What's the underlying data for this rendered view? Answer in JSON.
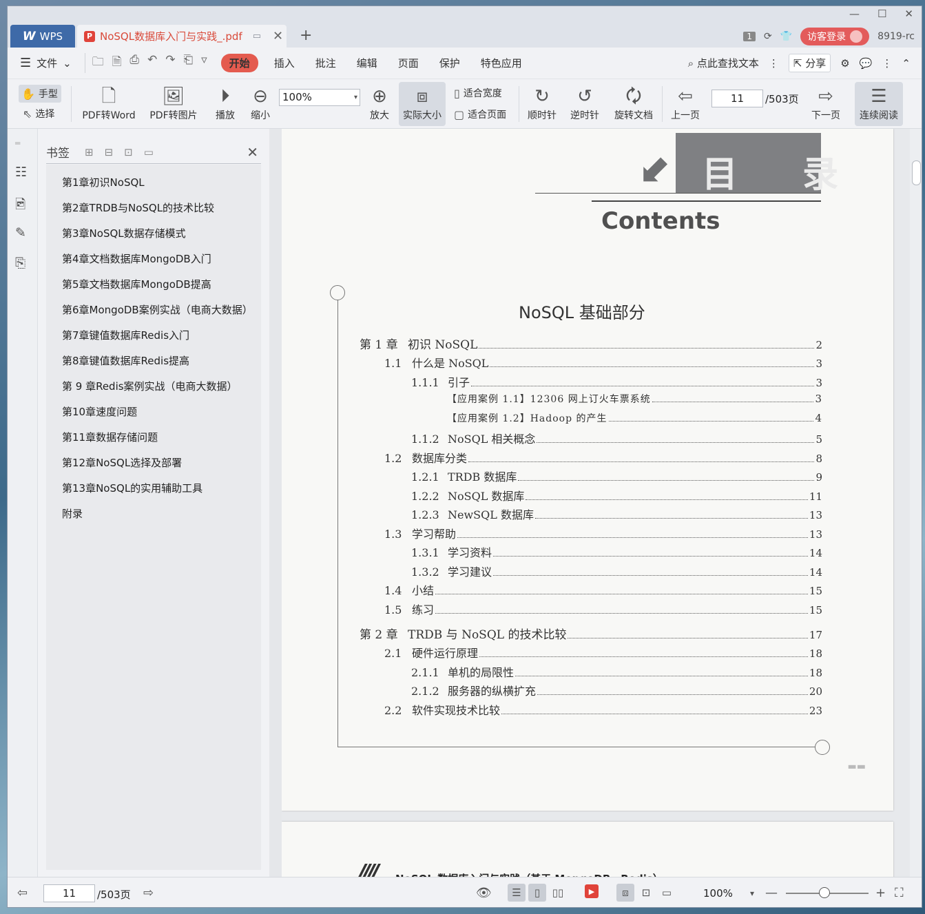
{
  "titlebar": {
    "app_name": "WPS",
    "doc_tab": "NoSQL数据库入门与实践_.pdf",
    "page_badge": "1",
    "login": "访客登录",
    "user_id": "8919-rc"
  },
  "menu": {
    "file": "文件",
    "tabs": [
      "开始",
      "插入",
      "批注",
      "编辑",
      "页面",
      "保护",
      "特色应用"
    ],
    "search": "点此查找文本",
    "share": "分享"
  },
  "toolbar": {
    "hand": "手型",
    "select": "选择",
    "pdf_to_word": "PDF转Word",
    "pdf_to_image": "PDF转图片",
    "play": "播放",
    "zoom_out": "缩小",
    "zoom_value": "100%",
    "zoom_in": "放大",
    "actual_size": "实际大小",
    "fit_width": "适合宽度",
    "fit_page": "适合页面",
    "rotate_cw": "顺时针",
    "rotate_ccw": "逆时针",
    "rotate_doc": "旋转文档",
    "prev_page": "上一页",
    "page_current": "11",
    "page_total": "/503页",
    "next_page": "下一页",
    "continuous": "连续阅读"
  },
  "bookmarks": {
    "title": "书签",
    "items": [
      "第1章初识NoSQL",
      "第2章TRDB与NoSQL的技术比较",
      "第3章NoSQL数据存储模式",
      "第4章文档数据库MongoDB入门",
      "第5章文档数据库MongoDB提高",
      "第6章MongoDB案例实战（电商大数据）",
      "第7章键值数据库Redis入门",
      "第8章键值数据库Redis提高",
      "第 9 章Redis案例实战（电商大数据）",
      "第10章速度问题",
      "第11章数据存储问题",
      "第12章NoSQL选择及部署",
      "第13章NoSQL的实用辅助工具",
      "附录"
    ]
  },
  "page": {
    "heading_cn": "目 录",
    "heading_en": "Contents",
    "part_title": "NoSQL 基础部分",
    "toc": [
      {
        "level": 0,
        "num": "第 1 章",
        "title": "初识 NoSQL",
        "page": "2"
      },
      {
        "level": 1,
        "num": "1.1",
        "title": "什么是 NoSQL",
        "page": "3"
      },
      {
        "level": 2,
        "num": "1.1.1",
        "title": "引子",
        "page": "3"
      },
      {
        "level": 3,
        "num": "",
        "title": "【应用案例 1.1】12306 网上订火车票系统",
        "page": "3"
      },
      {
        "level": 3,
        "num": "",
        "title": "【应用案例 1.2】Hadoop 的产生",
        "page": "4"
      },
      {
        "level": 2,
        "num": "1.1.2",
        "title": "NoSQL 相关概念",
        "page": "5"
      },
      {
        "level": 1,
        "num": "1.2",
        "title": "数据库分类",
        "page": "8"
      },
      {
        "level": 2,
        "num": "1.2.1",
        "title": "TRDB 数据库",
        "page": "9"
      },
      {
        "level": 2,
        "num": "1.2.2",
        "title": "NoSQL 数据库",
        "page": "11"
      },
      {
        "level": 2,
        "num": "1.2.3",
        "title": "NewSQL 数据库",
        "page": "13"
      },
      {
        "level": 1,
        "num": "1.3",
        "title": "学习帮助",
        "page": "13"
      },
      {
        "level": 2,
        "num": "1.3.1",
        "title": "学习资料",
        "page": "14"
      },
      {
        "level": 2,
        "num": "1.3.2",
        "title": "学习建议",
        "page": "14"
      },
      {
        "level": 1,
        "num": "1.4",
        "title": "小结",
        "page": "15"
      },
      {
        "level": 1,
        "num": "1.5",
        "title": "练习",
        "page": "15"
      },
      {
        "level": 0,
        "num": "第 2 章",
        "title": "TRDB 与 NoSQL 的技术比较",
        "page": "17"
      },
      {
        "level": 1,
        "num": "2.1",
        "title": "硬件运行原理",
        "page": "18"
      },
      {
        "level": 2,
        "num": "2.1.1",
        "title": "单机的局限性",
        "page": "18"
      },
      {
        "level": 2,
        "num": "2.1.2",
        "title": "服务器的纵横扩充",
        "page": "20"
      },
      {
        "level": 1,
        "num": "2.2",
        "title": "软件实现技术比较",
        "page": "23"
      }
    ],
    "next_page_header": "NoSQL 数据库入门与实践（基于 MongoDB、Redis）"
  },
  "statusbar": {
    "page_current": "11",
    "page_total": "/503页",
    "zoom": "100%"
  }
}
